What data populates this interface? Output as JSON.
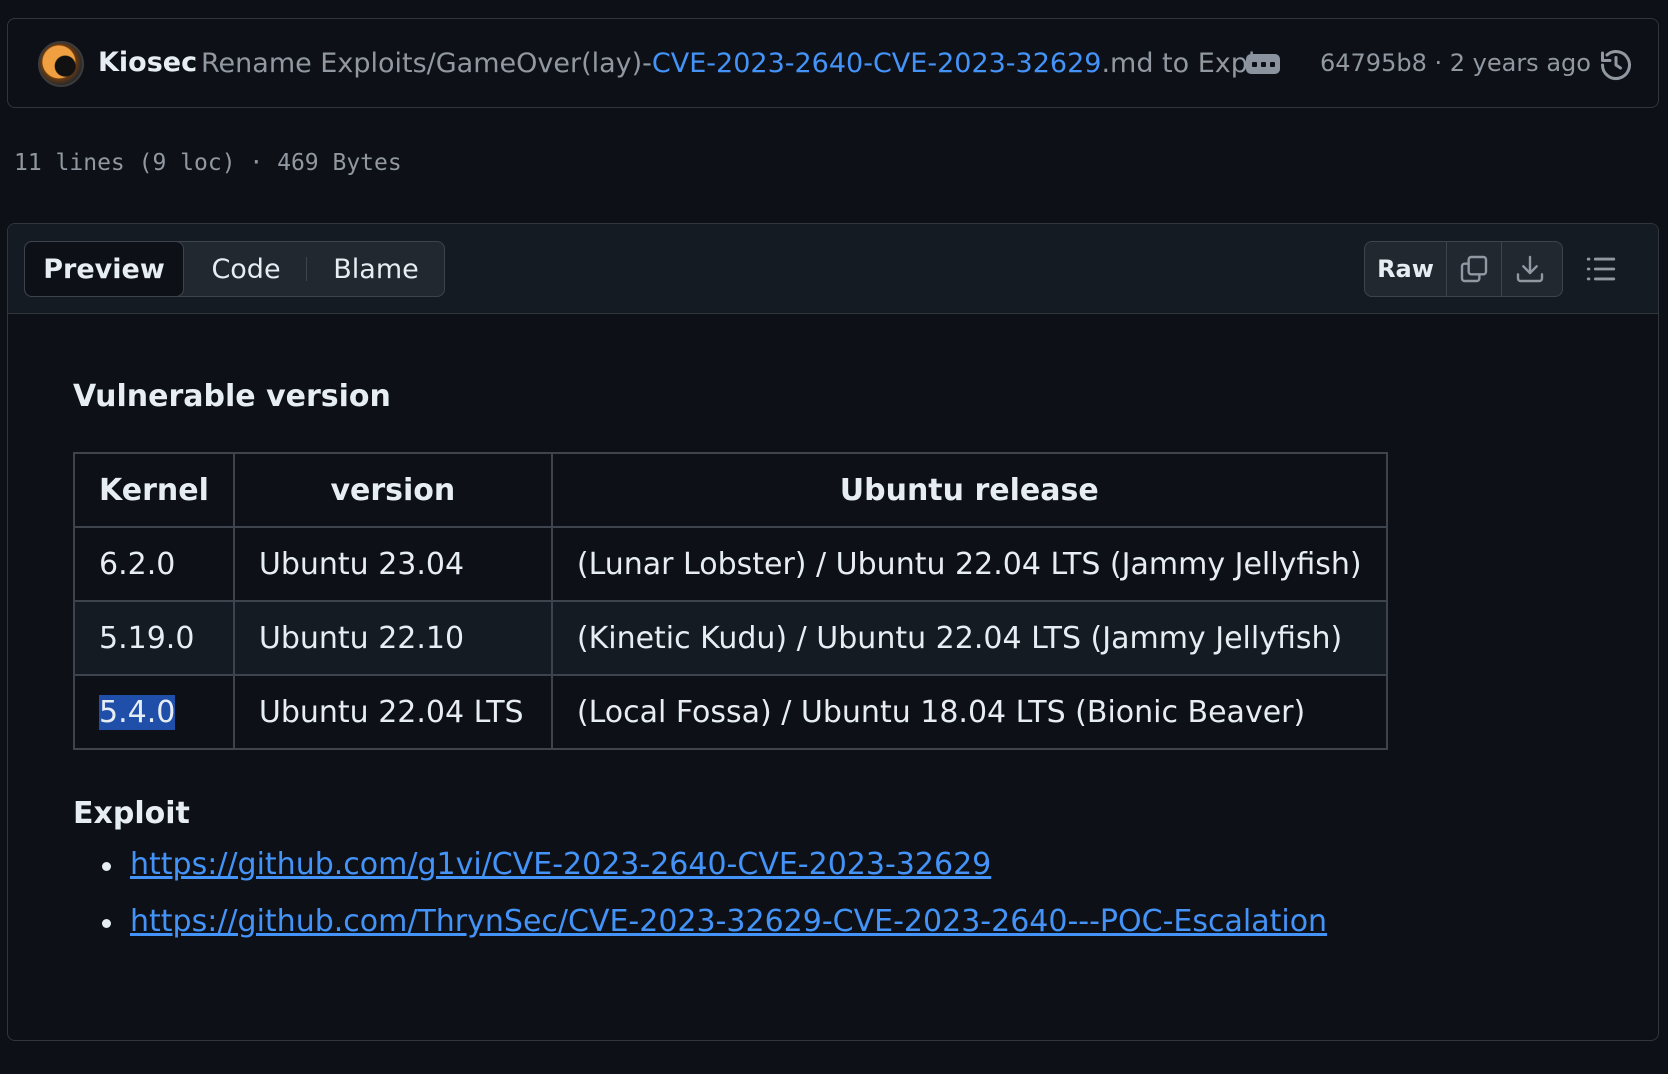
{
  "commit": {
    "author": "Kiosec",
    "message_prefix": "Rename Exploits/GameOver(lay)-",
    "message_link": "CVE-2023-2640-CVE-2023-32629",
    "message_suffix": ".md to Expl...",
    "sha_time": "64795b8 · 2 years ago"
  },
  "file_info": "11 lines (9 loc) · 469 Bytes",
  "tabs": {
    "preview": "Preview",
    "code": "Code",
    "blame": "Blame"
  },
  "actions": {
    "raw": "Raw"
  },
  "content": {
    "heading_vulnerable": "Vulnerable version",
    "table": {
      "headers": [
        "Kernel",
        "version",
        "Ubuntu release"
      ],
      "rows": [
        [
          "6.2.0",
          "Ubuntu 23.04",
          "(Lunar Lobster) / Ubuntu 22.04 LTS (Jammy Jellyfish)"
        ],
        [
          "5.19.0",
          "Ubuntu 22.10",
          "(Kinetic Kudu) / Ubuntu 22.04 LTS (Jammy Jellyfish)"
        ],
        [
          "5.4.0",
          "Ubuntu 22.04 LTS",
          "(Local Fossa) / Ubuntu 18.04 LTS (Bionic Beaver)"
        ]
      ]
    },
    "heading_exploit": "Exploit",
    "links": [
      "https://github.com/g1vi/CVE-2023-2640-CVE-2023-32629",
      "https://github.com/ThrynSec/CVE-2023-32629-CVE-2023-2640---POC-Escalation"
    ]
  },
  "colors": {
    "background": "#0d1117",
    "link": "#4493f8",
    "border": "#30363d",
    "muted": "#9198a1"
  }
}
